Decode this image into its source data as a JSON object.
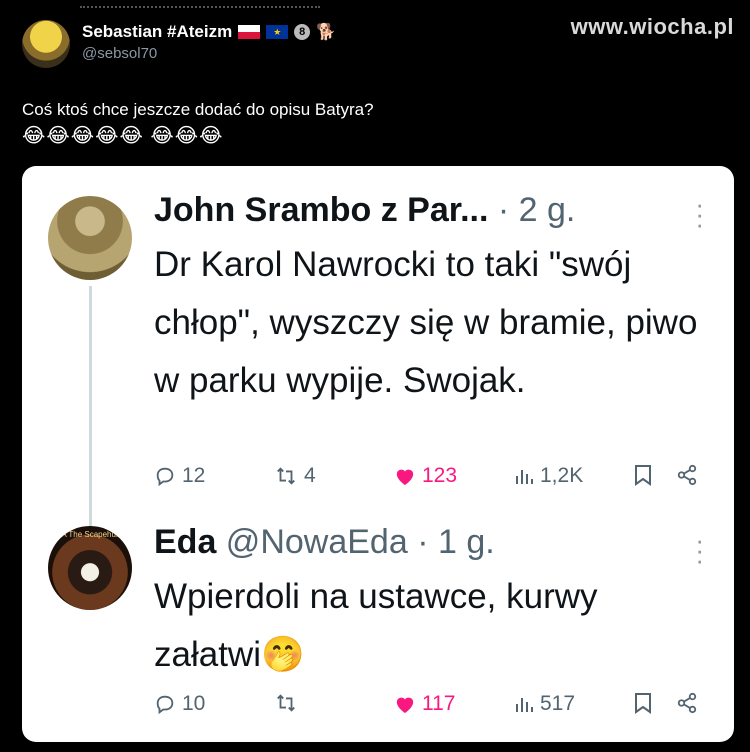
{
  "watermark": "www.wiocha.pl",
  "post": {
    "author_name": "Sebastian #Ateizm",
    "badge": "8",
    "handle": "@sebsol70",
    "text": "Coś ktoś chce jeszcze dodać do opisu Batyra?",
    "emojis": "😂😂😂😂😂 😂😂😂"
  },
  "replies": [
    {
      "name": "John Srambo z Par...",
      "meta": " · 2 g.",
      "text": "Dr Karol Nawrocki to taki \"swój chłop\", wyszczy się w bramie, piwo w parku wypije. Swojak.",
      "replies_count": "12",
      "reposts_count": "4",
      "likes_count": "123",
      "views_count": "1,2K"
    },
    {
      "name": "Eda",
      "meta": " @NowaEda · 1 g.",
      "avatar_label": "EDA The Scapehunter",
      "text": "Wpierdoli na ustawce, kurwy załatwi🤭",
      "replies_count": "10",
      "reposts_count": "",
      "likes_count": "117",
      "views_count": "517"
    }
  ],
  "colors": {
    "like": "#f91880",
    "meta": "#536471",
    "background": "#000000",
    "card": "#ffffff"
  },
  "icons": [
    "reply-icon",
    "repost-icon",
    "heart-icon",
    "views-icon",
    "bookmark-icon",
    "share-icon",
    "more-icon"
  ]
}
